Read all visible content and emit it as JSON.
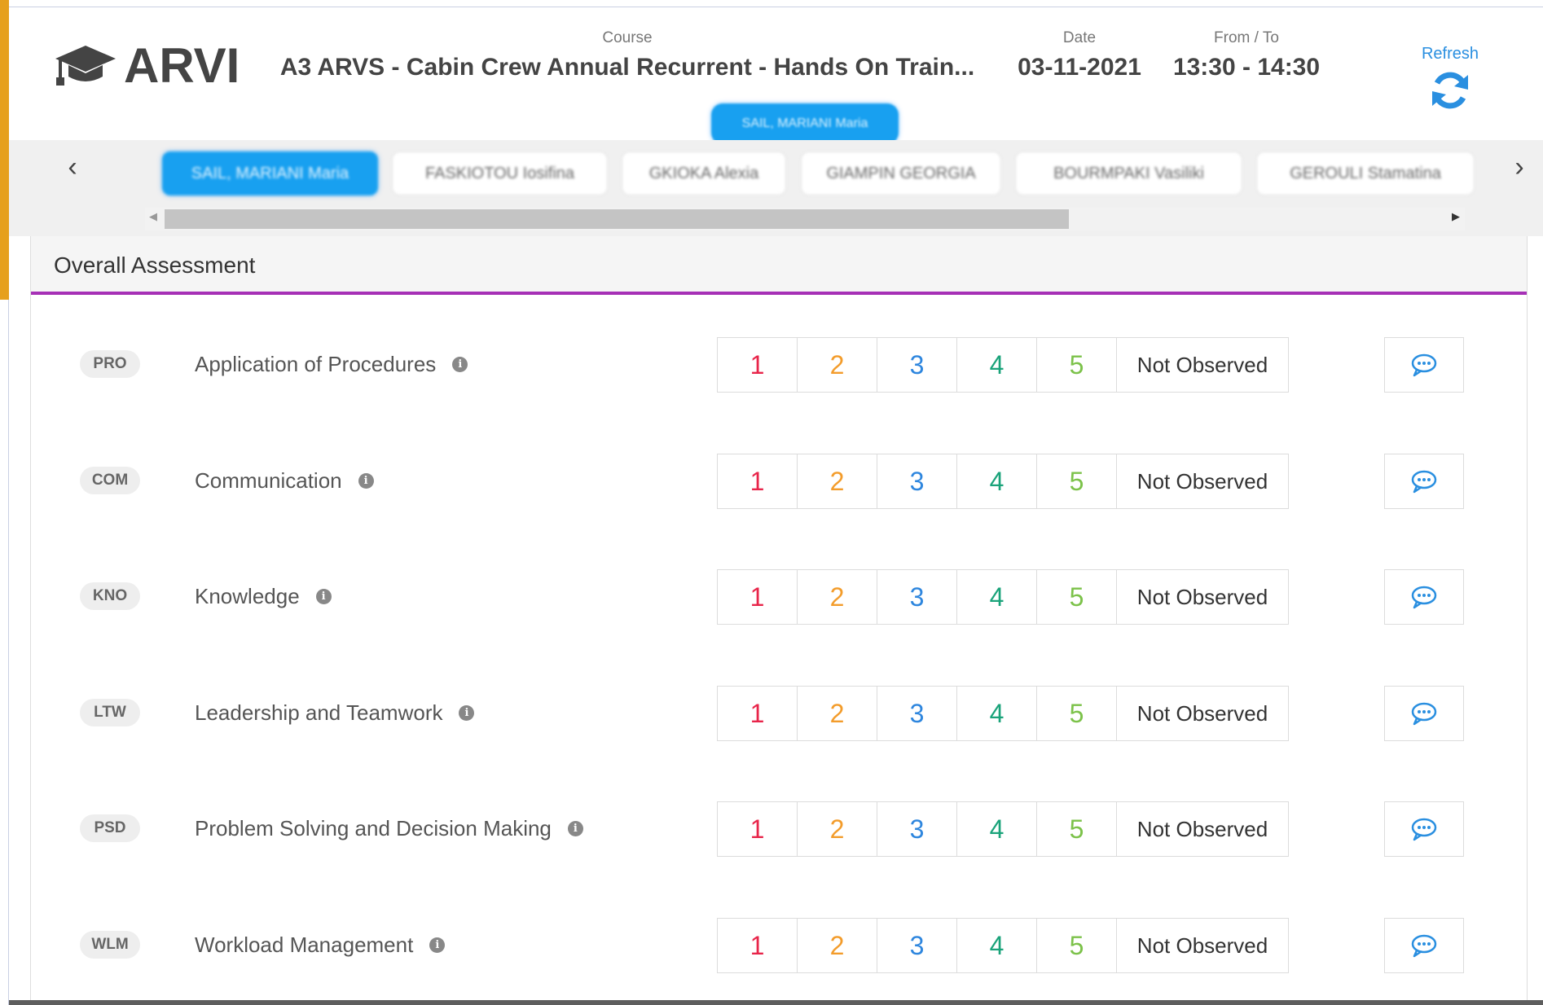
{
  "header": {
    "logo_text": "ARVI",
    "course_label": "Course",
    "course_value": "A3 ARVS - Cabin Crew Annual Recurrent - Hands On Train...",
    "date_label": "Date",
    "date_value": "03-11-2021",
    "fromto_label": "From / To",
    "fromto_value": "13:30 - 14:30",
    "refresh_label": "Refresh",
    "active_trainee": "SAIL, MARIANI Maria"
  },
  "trainee_tabs": [
    {
      "label": "SAIL, MARIANI Maria",
      "active": true
    },
    {
      "label": "FASKIOTOU Iosifina",
      "active": false
    },
    {
      "label": "GKIOKA Alexia",
      "active": false
    },
    {
      "label": "GIAMPIN GEORGIA",
      "active": false
    },
    {
      "label": "BOURMPAKI Vasiliki",
      "active": false
    },
    {
      "label": "GEROULI Stamatina",
      "active": false
    }
  ],
  "panel": {
    "title": "Overall Assessment"
  },
  "score_options": [
    "1",
    "2",
    "3",
    "4",
    "5"
  ],
  "not_observed_label": "Not Observed",
  "criteria": [
    {
      "code": "PRO",
      "label": "Application of Procedures"
    },
    {
      "code": "COM",
      "label": "Communication"
    },
    {
      "code": "KNO",
      "label": "Knowledge"
    },
    {
      "code": "LTW",
      "label": "Leadership and Teamwork"
    },
    {
      "code": "PSD",
      "label": "Problem Solving and Decision Making"
    },
    {
      "code": "WLM",
      "label": "Workload Management"
    }
  ],
  "colors": {
    "accent": "#18a0f0",
    "panel_rule": "#a630b6",
    "score_1": "#e8254a",
    "score_2": "#f39c2b",
    "score_3": "#2e86de",
    "score_4": "#1aa37a",
    "score_5": "#7cc24a"
  },
  "icons": {
    "logo": "graduation-cap-icon",
    "refresh": "refresh-icon",
    "info": "info-icon",
    "comment": "comment-icon",
    "nav_prev": "chevron-left-icon",
    "nav_next": "chevron-right-icon"
  }
}
